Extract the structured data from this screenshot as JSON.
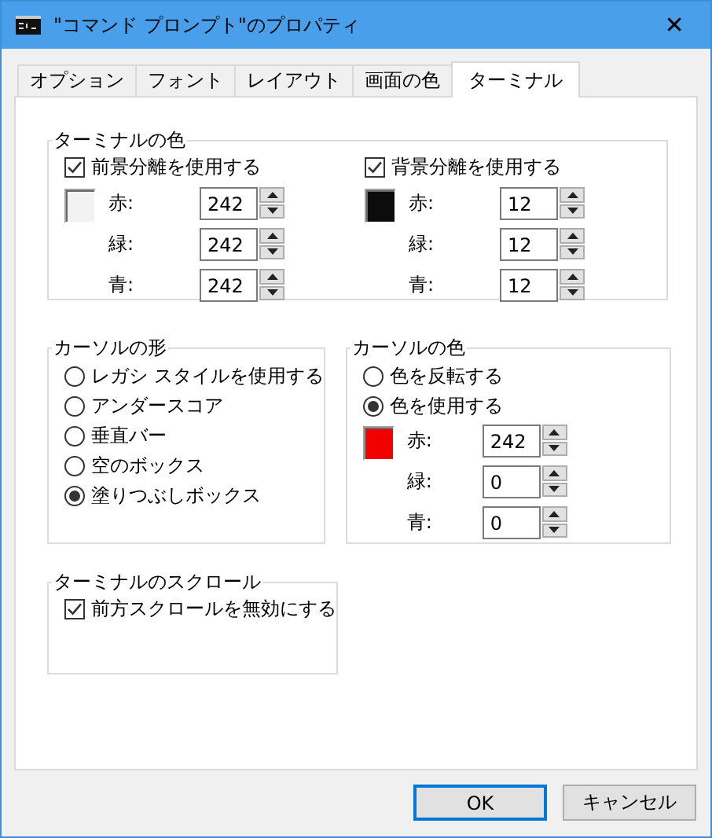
{
  "window": {
    "title": "\"コマンド プロンプト\"のプロパティ",
    "close": "✕"
  },
  "tabs": [
    {
      "label": "オプション",
      "selected": false
    },
    {
      "label": "フォント",
      "selected": false
    },
    {
      "label": "レイアウト",
      "selected": false
    },
    {
      "label": "画面の色",
      "selected": false
    },
    {
      "label": "ターミナル",
      "selected": true
    }
  ],
  "terminal_colors": {
    "title": "ターミナルの色",
    "columns": [
      {
        "checkbox": {
          "label": "前景分離を使用する",
          "checked": true
        },
        "swatch": {
          "color": "#f2f2f2"
        },
        "channels": [
          {
            "label": "赤:",
            "value": "242"
          },
          {
            "label": "緑:",
            "value": "242"
          },
          {
            "label": "青:",
            "value": "242"
          }
        ]
      },
      {
        "checkbox": {
          "label": "背景分離を使用する",
          "checked": true
        },
        "swatch": {
          "color": "#0c0c0c"
        },
        "channels": [
          {
            "label": "赤:",
            "value": "12"
          },
          {
            "label": "緑:",
            "value": "12"
          },
          {
            "label": "青:",
            "value": "12"
          }
        ]
      }
    ]
  },
  "cursor_shape": {
    "title": "カーソルの形",
    "options": [
      {
        "label": "レガシ スタイルを使用する",
        "selected": false
      },
      {
        "label": "アンダースコア",
        "selected": false
      },
      {
        "label": "垂直バー",
        "selected": false
      },
      {
        "label": "空のボックス",
        "selected": false
      },
      {
        "label": "塗りつぶしボックス",
        "selected": true
      }
    ]
  },
  "cursor_color": {
    "title": "カーソルの色",
    "options": [
      {
        "label": "色を反転する",
        "selected": false
      },
      {
        "label": "色を使用する",
        "selected": true
      }
    ],
    "swatch": {
      "color": "#f20000"
    },
    "channels": [
      {
        "label": "赤:",
        "value": "242"
      },
      {
        "label": "緑:",
        "value": "0"
      },
      {
        "label": "青:",
        "value": "0"
      }
    ]
  },
  "scroll": {
    "title": "ターミナルのスクロール",
    "checkbox": {
      "label": "前方スクロールを無効にする",
      "checked": true
    }
  },
  "buttons": [
    {
      "label": "OK",
      "kind": "default"
    },
    {
      "label": "キャンセル",
      "kind": "normal"
    }
  ]
}
